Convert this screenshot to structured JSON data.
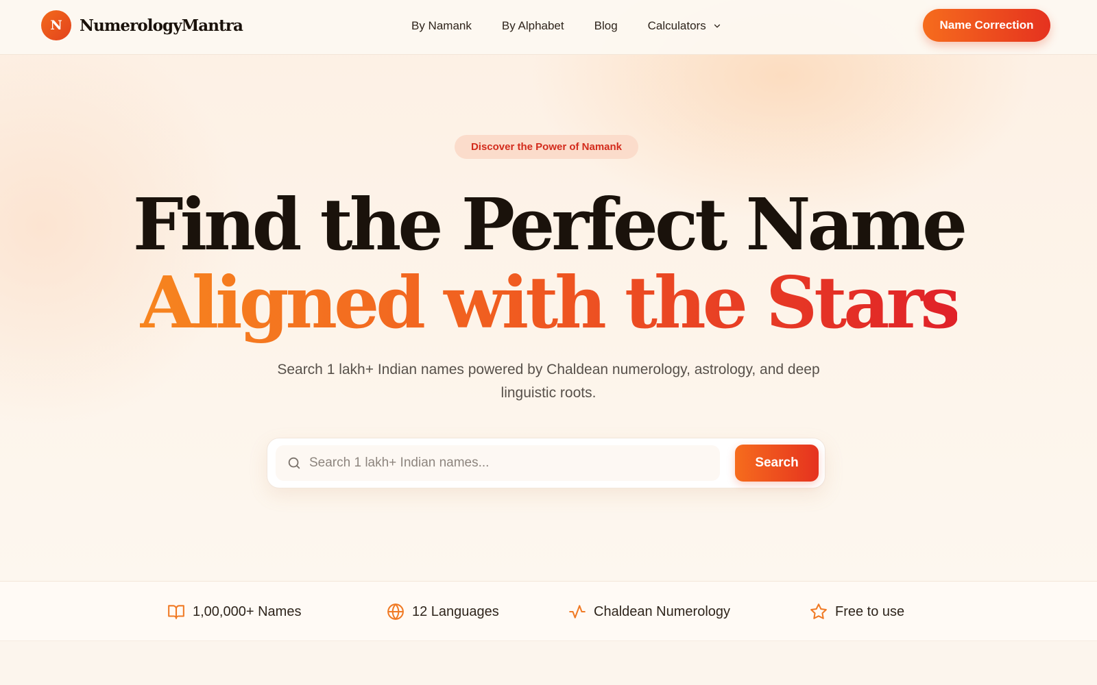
{
  "brand": {
    "logo_letter": "N",
    "name": "NumerologyMantra"
  },
  "nav": {
    "items": [
      {
        "label": "By Namank"
      },
      {
        "label": "By Alphabet"
      },
      {
        "label": "Blog"
      },
      {
        "label": "Calculators",
        "icon": "chevron-down-icon"
      }
    ]
  },
  "header_cta": {
    "label": "Name Correction"
  },
  "hero": {
    "badge": "Discover the Power of Namank",
    "headline_line1": "Find the Perfect Name",
    "headline_line2": "Aligned with the Stars",
    "subtitle": "Search 1 lakh+ Indian names powered by Chaldean numerology, astrology, and deep linguistic roots."
  },
  "search": {
    "placeholder": "Search 1 lakh+ Indian names...",
    "value": "",
    "button_label": "Search",
    "icon": "search-icon"
  },
  "features": [
    {
      "label": "1,00,000+ Names",
      "icon": "book-icon"
    },
    {
      "label": "12 Languages",
      "icon": "globe-icon"
    },
    {
      "label": "Chaldean Numerology",
      "icon": "activity-icon"
    },
    {
      "label": "Free to use",
      "icon": "star-icon"
    }
  ],
  "colors": {
    "accent_start": "#f66c1d",
    "accent_end": "#e5321f",
    "heading_dark": "#1a120b",
    "badge_bg": "#fbdccb",
    "badge_text": "#d32b1c",
    "icon_orange": "#f07a25",
    "page_bg": "#fdf6ee"
  }
}
